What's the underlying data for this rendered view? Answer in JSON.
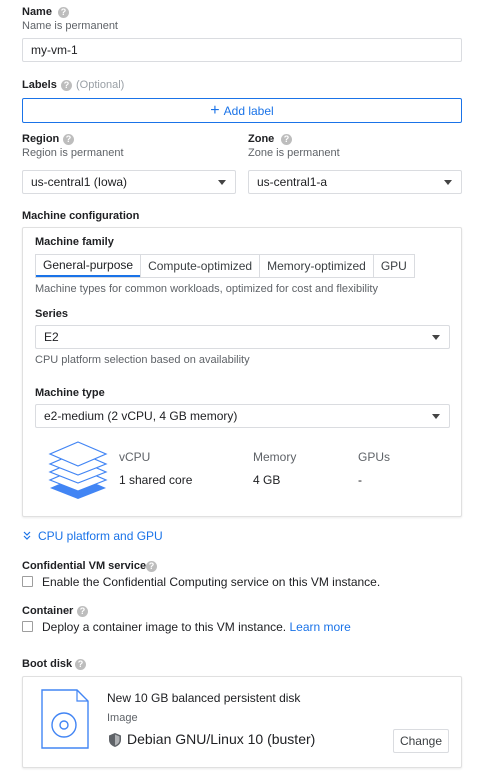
{
  "name": {
    "label": "Name",
    "hint": "Name is permanent",
    "value": "my-vm-1"
  },
  "labels": {
    "label": "Labels",
    "optional": "(Optional)",
    "add_button": "Add label"
  },
  "region": {
    "label": "Region",
    "hint": "Region is permanent",
    "value": "us-central1 (Iowa)"
  },
  "zone": {
    "label": "Zone",
    "hint": "Zone is permanent",
    "value": "us-central1-a"
  },
  "machine": {
    "section_label": "Machine configuration",
    "family_label": "Machine family",
    "tabs": [
      "General-purpose",
      "Compute-optimized",
      "Memory-optimized",
      "GPU"
    ],
    "active_tab": 0,
    "family_desc": "Machine types for common workloads, optimized for cost and flexibility",
    "series_label": "Series",
    "series_value": "E2",
    "series_desc": "CPU platform selection based on availability",
    "type_label": "Machine type",
    "type_value": "e2-medium (2 vCPU, 4 GB memory)",
    "specs": {
      "vcpu_header": "vCPU",
      "vcpu_value": "1 shared core",
      "memory_header": "Memory",
      "memory_value": "4 GB",
      "gpus_header": "GPUs",
      "gpus_value": "-"
    }
  },
  "cpu_platform_link": "CPU platform and GPU",
  "confidential": {
    "label": "Confidential VM service",
    "checkbox_label": "Enable the Confidential Computing service on this VM instance."
  },
  "container": {
    "label": "Container",
    "checkbox_label": "Deploy a container image to this VM instance.",
    "learn_more": "Learn more"
  },
  "boot_disk": {
    "label": "Boot disk",
    "title": "New 10 GB balanced persistent disk",
    "image_label": "Image",
    "image_value": "Debian GNU/Linux 10 (buster)",
    "change_button": "Change"
  },
  "help_glyph": "?",
  "colors": {
    "accent": "#1a73e8",
    "stack_blue": "#4285f4"
  }
}
